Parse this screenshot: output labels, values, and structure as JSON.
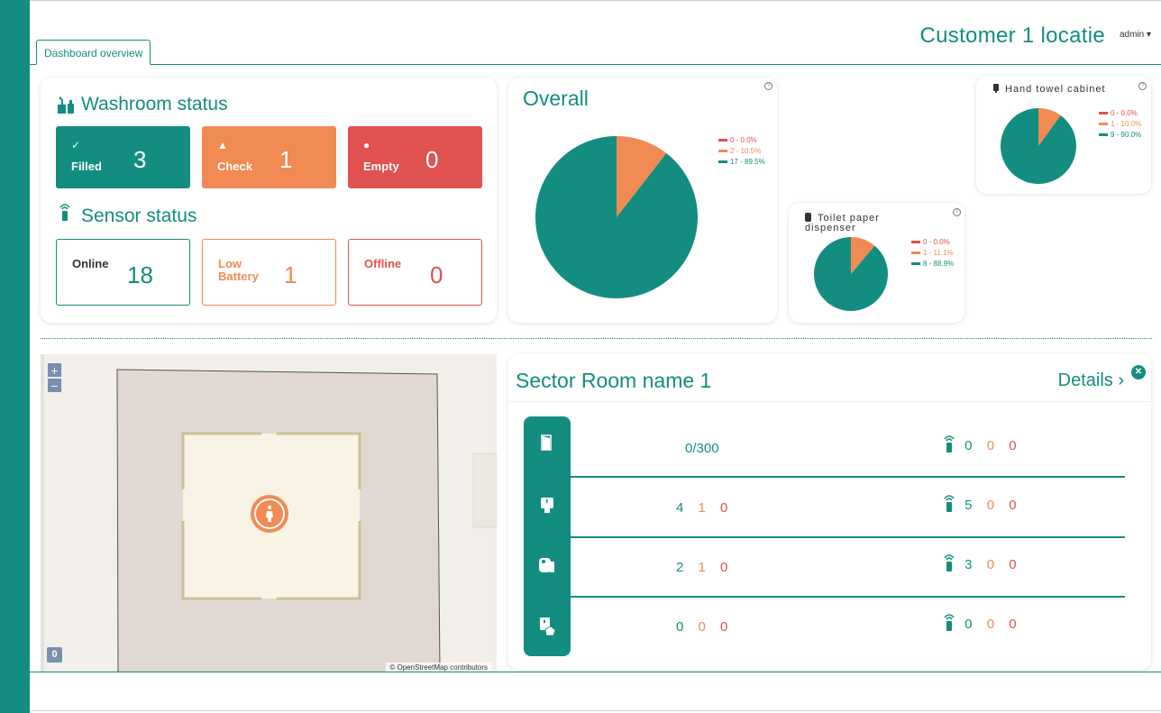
{
  "header": {
    "tab_label": "Dashboard overview",
    "title": "Customer 1 locatie",
    "user": "admin ▾"
  },
  "colors": {
    "accent": "#138d7f",
    "warning": "#f28a54",
    "danger": "#e0514f"
  },
  "washroom_status": {
    "title": "Washroom status",
    "filled": {
      "icon": "✓",
      "label": "Filled",
      "value": "3"
    },
    "check": {
      "icon": "▲",
      "label": "Check",
      "value": "1"
    },
    "empty": {
      "icon": "●",
      "label": "Empty",
      "value": "0"
    }
  },
  "sensor_status": {
    "title": "Sensor status",
    "online": {
      "label": "Online",
      "value": "18"
    },
    "low_battery": {
      "label_line1": "Low",
      "label_line2": "Battery",
      "value": "1"
    },
    "offline": {
      "label": "Offline",
      "value": "0"
    }
  },
  "charts": {
    "overall_title": "Overall",
    "toilet_paper_title_line1": "Toilet paper",
    "toilet_paper_title_line2": "dispenser",
    "hand_towel_title": "Hand towel cabinet"
  },
  "chart_data": [
    {
      "type": "pie",
      "title": "Overall",
      "legend": [
        "0 - 0.0%",
        "2 - 10.5%",
        "17 - 89.5%"
      ],
      "values": [
        0,
        2,
        17
      ],
      "percentages": [
        0.0,
        10.5,
        89.5
      ],
      "colors": [
        "#e0514f",
        "#f28a54",
        "#138d7f"
      ]
    },
    {
      "type": "pie",
      "title": "Toilet paper dispenser",
      "legend": [
        "0 - 0.0%",
        "1 - 11.1%",
        "8 - 88.9%"
      ],
      "values": [
        0,
        1,
        8
      ],
      "percentages": [
        0.0,
        11.1,
        88.9
      ],
      "colors": [
        "#e0514f",
        "#f28a54",
        "#138d7f"
      ]
    },
    {
      "type": "pie",
      "title": "Hand towel cabinet",
      "legend": [
        "0 - 0.0%",
        "1 - 10.0%",
        "9 - 90.0%"
      ],
      "values": [
        0,
        1,
        9
      ],
      "percentages": [
        0.0,
        10.0,
        90.0
      ],
      "colors": [
        "#e0514f",
        "#f28a54",
        "#138d7f"
      ]
    }
  ],
  "map": {
    "zoom_in": "+",
    "zoom_out": "−",
    "attribution": "© OpenStreetMap contributors",
    "badge": "0",
    "marker_icon": "female-toilet-icon"
  },
  "sector": {
    "title": "Sector Room name 1",
    "details_label": "Details ›",
    "close_icon": "✕",
    "rows": [
      {
        "icon": "door-icon",
        "count": "0/300",
        "sensors": [
          "0",
          "0",
          "0"
        ]
      },
      {
        "icon": "soap-dispenser-icon",
        "values": [
          "4",
          "1",
          "0"
        ],
        "sensors": [
          "5",
          "0",
          "0"
        ]
      },
      {
        "icon": "toilet-paper-icon",
        "values": [
          "2",
          "1",
          "0"
        ],
        "sensors": [
          "3",
          "0",
          "0"
        ]
      },
      {
        "icon": "hand-towel-icon",
        "values": [
          "0",
          "0",
          "0"
        ],
        "sensors": [
          "0",
          "0",
          "0"
        ]
      }
    ]
  }
}
